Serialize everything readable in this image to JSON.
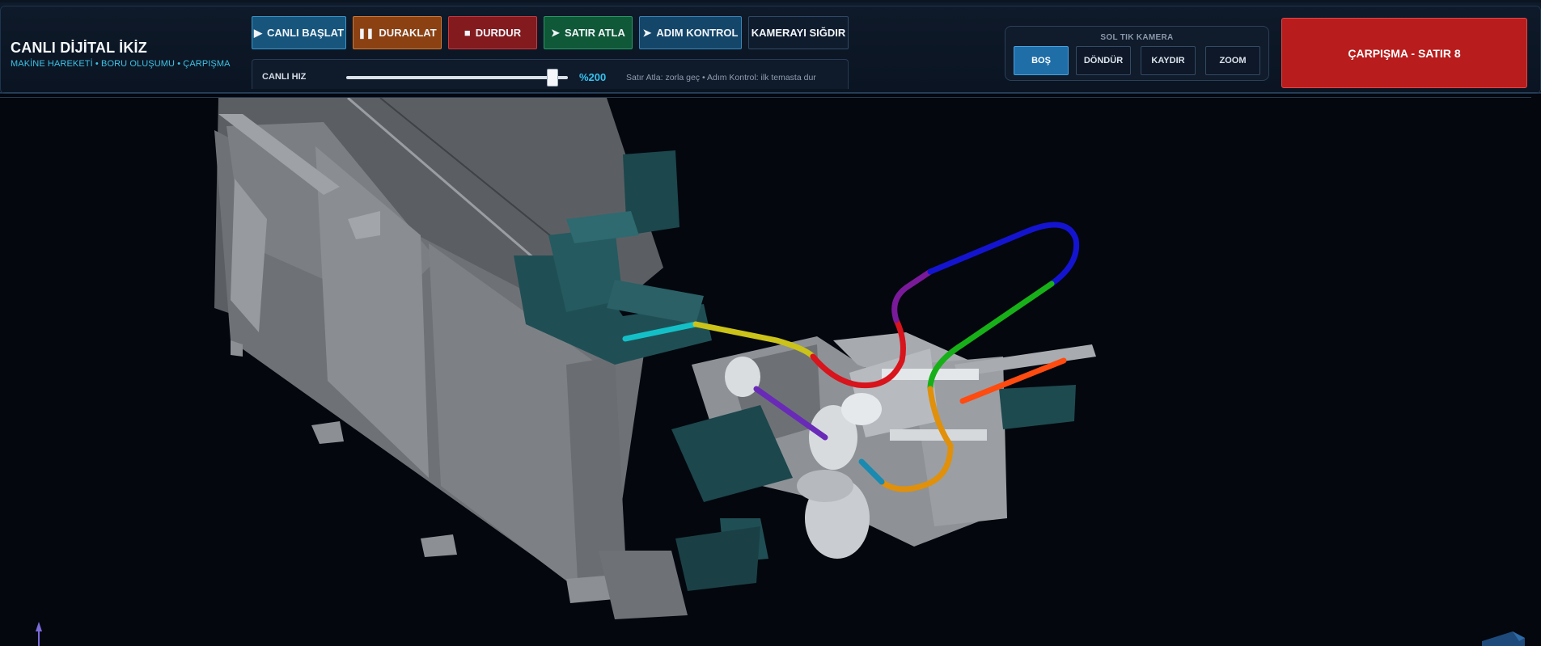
{
  "brand": {
    "title": "CANLI DİJİTAL İKİZ",
    "subtitle": "MAKİNE HAREKETİ • BORU OLUŞUMU • ÇARPIŞMA"
  },
  "controls": {
    "start": {
      "icon": "play-icon",
      "label": "CANLI BAŞLAT"
    },
    "pause": {
      "icon": "pause-icon",
      "label": "DURAKLAT"
    },
    "stop": {
      "icon": "stop-icon",
      "label": "DURDUR"
    },
    "skip": {
      "icon": "skip-icon",
      "label": "SATIR ATLA"
    },
    "step": {
      "icon": "step-icon",
      "label": "ADIM KONTROL"
    },
    "fit": {
      "label": "KAMERAYI SIĞDIR"
    }
  },
  "speed": {
    "label": "CANLI HIZ",
    "value_text": "%200",
    "slider_fraction": 0.93,
    "hint": "Satır Atla: zorla geç • Adım Kontrol: ilk temasta dur"
  },
  "camera": {
    "title": "SOL TIK KAMERA",
    "modes": [
      "BOŞ",
      "DÖNDÜR",
      "KAYDIR",
      "ZOOM"
    ],
    "active_mode": "BOŞ"
  },
  "collision": {
    "label": "ÇARPIŞMA - SATIR 8"
  },
  "colors": {
    "accent": "#3dc3e6",
    "collision": "#b91c1c",
    "tube_segments": [
      "#14c0c8",
      "#cbc21a",
      "#d8141c",
      "#7a1a9a",
      "#1414d0",
      "#18b018",
      "#e0900a",
      "#1a8ab0",
      "#6a2ab8",
      "#ff4b10"
    ]
  }
}
